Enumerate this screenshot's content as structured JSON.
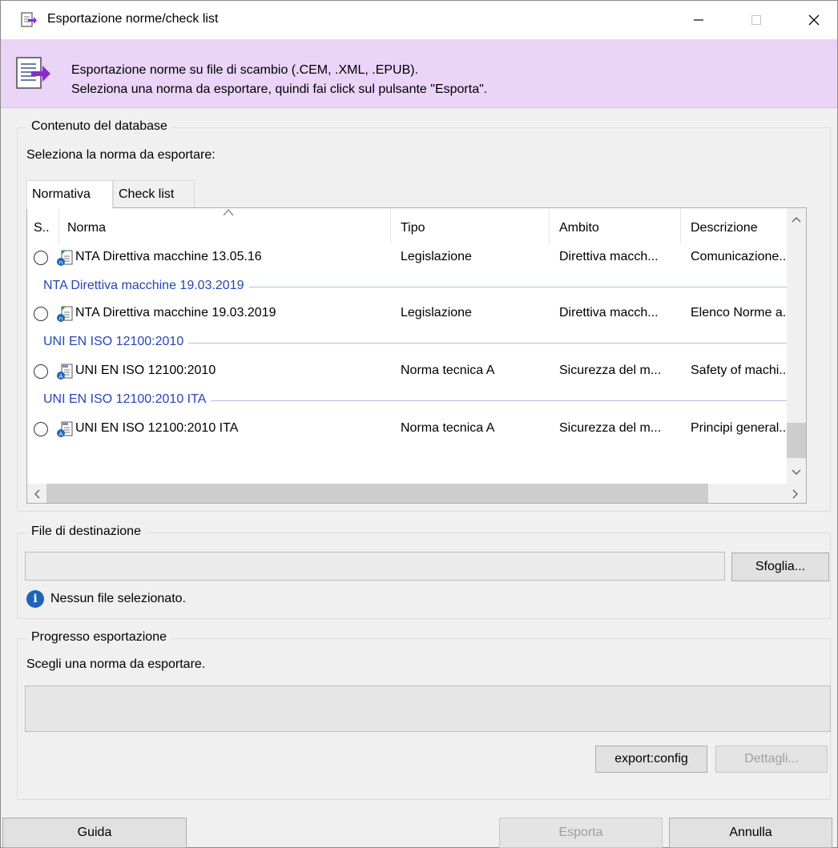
{
  "window": {
    "title": "Esportazione norme/check list",
    "minimize_glyph": "—",
    "close_glyph": "✕"
  },
  "banner": {
    "line1": "Esportazione norme su file di scambio (.CEM, .XML, .EPUB).",
    "line2": "Seleziona una norma da esportare, quindi fai click sul pulsante \"Esporta\".",
    "background": "#ead4f7",
    "accent": "#8a2bd0"
  },
  "database": {
    "group_title": "Contenuto del database",
    "prompt": "Seleziona la norma da esportare:",
    "tabs": [
      "Normativa",
      "Check list"
    ],
    "columns": [
      "S..",
      "Norma",
      "Tipo",
      "Ambito",
      "Descrizione"
    ],
    "rows": [
      {
        "kind": "item",
        "norma": "NTA Direttiva macchine 13.05.16",
        "tipo": "Legislazione",
        "ambito": "Direttiva macch...",
        "descrizione": "Comunicazione..",
        "icon": "legislation-doc-icon"
      },
      {
        "kind": "group",
        "label": "NTA Direttiva macchine 19.03.2019"
      },
      {
        "kind": "item",
        "norma": "NTA Direttiva macchine 19.03.2019",
        "tipo": "Legislazione",
        "ambito": "Direttiva macch...",
        "descrizione": "Elenco Norme a..",
        "icon": "legislation-doc-icon"
      },
      {
        "kind": "group",
        "label": "UNI EN ISO 12100:2010"
      },
      {
        "kind": "item",
        "norma": "UNI EN ISO 12100:2010",
        "tipo": "Norma tecnica A",
        "ambito": "Sicurezza del m...",
        "descrizione": "Safety of machi...",
        "icon": "standard-doc-icon"
      },
      {
        "kind": "group",
        "label": "UNI EN ISO 12100:2010 ITA"
      },
      {
        "kind": "item",
        "norma": "UNI EN ISO 12100:2010 ITA",
        "tipo": "Norma tecnica A",
        "ambito": "Sicurezza del m...",
        "descrizione": "Principi general...",
        "icon": "standard-doc-icon"
      }
    ],
    "group_color": "#2845b5"
  },
  "destination": {
    "group_title": "File di destinazione",
    "file_value": "",
    "browse_label": "Sfoglia...",
    "status": "Nessun file selezionato."
  },
  "progress": {
    "group_title": "Progresso esportazione",
    "status": "Scegli una norma da esportare.",
    "value": 0,
    "config_label": "export:config",
    "details_label": "Dettagli..."
  },
  "footer": {
    "help_label": "Guida",
    "export_label": "Esporta",
    "cancel_label": "Annulla"
  }
}
